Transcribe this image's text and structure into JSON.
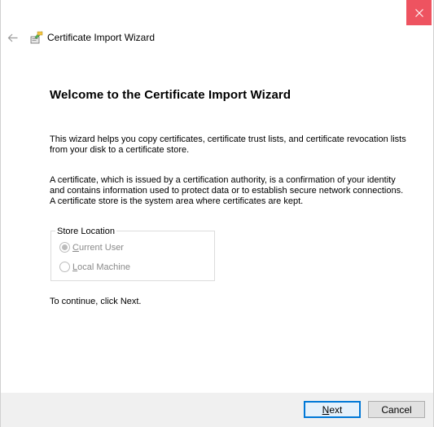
{
  "window": {
    "title": "Certificate Import Wizard"
  },
  "header": {
    "title": "Certificate Import Wizard"
  },
  "main": {
    "heading": "Welcome to the Certificate Import Wizard",
    "paragraph1": "This wizard helps you copy certificates, certificate trust lists, and certificate revocation lists from your disk to a certificate store.",
    "paragraph2": "A certificate, which is issued by a certification authority, is a confirmation of your identity and contains information used to protect data or to establish secure network connections. A certificate store is the system area where certificates are kept.",
    "store_location": {
      "label": "Store Location",
      "options": [
        {
          "label": "Current User",
          "selected": true,
          "disabled": true
        },
        {
          "label": "Local Machine",
          "selected": false,
          "disabled": true
        }
      ]
    },
    "continue_text": "To continue, click Next."
  },
  "footer": {
    "next_label": "Next",
    "cancel_label": "Cancel"
  },
  "colors": {
    "close_button": "#e81123",
    "default_button_border": "#0078d7",
    "footer_bg": "#f0f0f0"
  },
  "icons": [
    "close-icon",
    "back-arrow-icon",
    "certificate-wizard-icon"
  ]
}
